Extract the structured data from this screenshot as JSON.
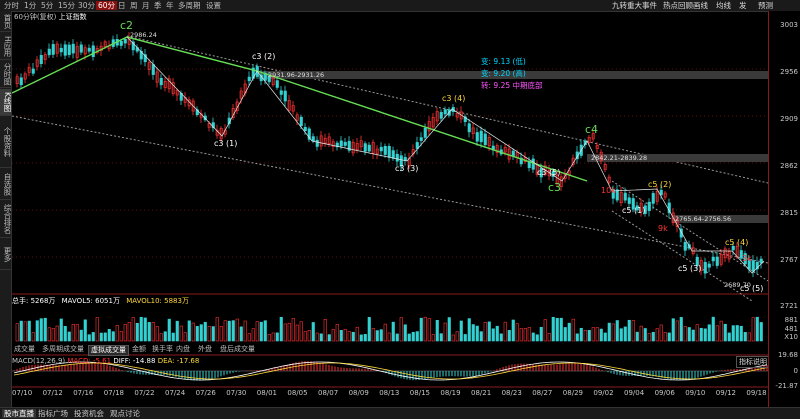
{
  "toolbar": {
    "periods": [
      "分时",
      "1分",
      "5分",
      "15分",
      "30分",
      "60分",
      "日",
      "周",
      "月",
      "季",
      "年",
      "多周期",
      "设置"
    ],
    "active_period": "60分",
    "right_items": [
      "九转",
      "重大事件",
      "热点回顾",
      "画线",
      "均线",
      "发",
      "预测"
    ]
  },
  "sidebar": [
    "首页",
    "H应用",
    "分时图",
    "K线图",
    "个股资料",
    "自选股",
    "综合排名",
    "更多"
  ],
  "sidebar_active": "K线图",
  "chart": {
    "header_label": "60分钟(复权)",
    "index_name": "上证指数"
  },
  "price_axis": [
    "3003",
    "2956",
    "2909",
    "2862",
    "2815",
    "2767",
    "2721"
  ],
  "forecast": {
    "line1": "变: 9.13 (低)",
    "line2": "变: 9.20 (高)",
    "line3": "转: 9.25 中期底部"
  },
  "wave_labels": [
    "c2",
    "c3 (2)",
    "c3 (1)",
    "c3 (4)",
    "c3 (3)",
    "c3 (5)",
    "c3",
    "c4",
    "10k",
    "c5 (1)",
    "c5 (2)",
    "9k",
    "c5 (3)",
    "c5 (4)",
    "3k",
    "c5 (5)"
  ],
  "annotations": [
    "2986.24",
    "2931.96-2931.26",
    "2842.21-2839.28",
    "2765.64-2756.56",
    "2689.70"
  ],
  "volume": {
    "total_label": "总手: 5268万",
    "ma5_label": "MAVOL5: 6051万",
    "ma10_label": "MAVOL10: 5883万",
    "axis": [
      "881",
      "481",
      "X10"
    ]
  },
  "subtabs": [
    "成交量",
    "多周期成交量",
    "虚拟成交量",
    "金额",
    "换手率",
    "内盘",
    "外盘",
    "盘后成交量"
  ],
  "active_subtab": "虚拟成交量",
  "macd": {
    "title": "MACD(12,26,9)",
    "macd_label": "MACD: -5.61",
    "diff_label": "DIFF: -14.88",
    "dea_label": "DEA: -17.68",
    "help": "指标说明",
    "axis": [
      "19.68",
      "0",
      "-21.87"
    ]
  },
  "dates": [
    "07/10",
    "07/12",
    "07/16",
    "07/18",
    "07/22",
    "07/24",
    "07/26",
    "07/30",
    "08/01",
    "08/05",
    "08/07",
    "08/09",
    "08/13",
    "08/15",
    "08/19",
    "08/21",
    "08/23",
    "08/27",
    "08/29",
    "09/02",
    "09/04",
    "09/06",
    "09/10",
    "09/12",
    "09/18"
  ],
  "indicator_tabs": [
    "指标",
    "MACD",
    "KDJ",
    "RSI",
    "BOLL",
    "OBV",
    "SAR"
  ],
  "active_indicator": "MACD",
  "bottom_tabs": [
    "股市直播",
    "指标广场",
    "投资机会",
    "观点讨论"
  ],
  "bottom_new_badge": "NEW",
  "colors": {
    "up": "#ff3333",
    "down": "#32d2d2",
    "wave": "#66dd55",
    "forecast": "#00d8ff",
    "forecast_mid": "#ff55ff"
  }
}
